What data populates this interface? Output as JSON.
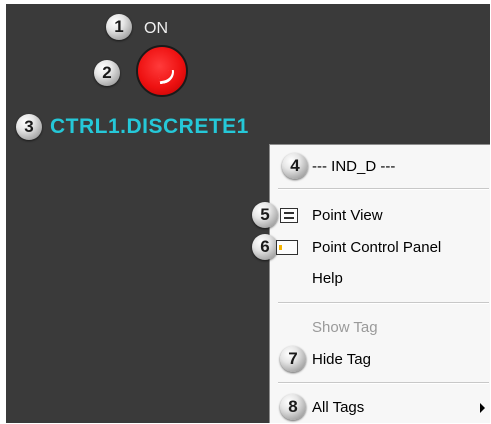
{
  "callouts": [
    "1",
    "2",
    "3",
    "4",
    "5",
    "6",
    "7",
    "8"
  ],
  "indicator": {
    "status_text": "ON",
    "led_color": "#ee1111",
    "tag_name": "CTRL1.DISCRETE1",
    "tag_color": "#25c8d8"
  },
  "context_menu": {
    "header": "--- IND_D ---",
    "items": [
      {
        "label": "Point View",
        "icon": "point-view-icon"
      },
      {
        "label": "Point Control Panel",
        "icon": "point-control-panel-icon"
      },
      {
        "label": "Help"
      },
      {
        "label": "Show Tag",
        "disabled": true
      },
      {
        "label": "Hide Tag"
      },
      {
        "label": "All Tags",
        "submenu": true
      }
    ]
  }
}
